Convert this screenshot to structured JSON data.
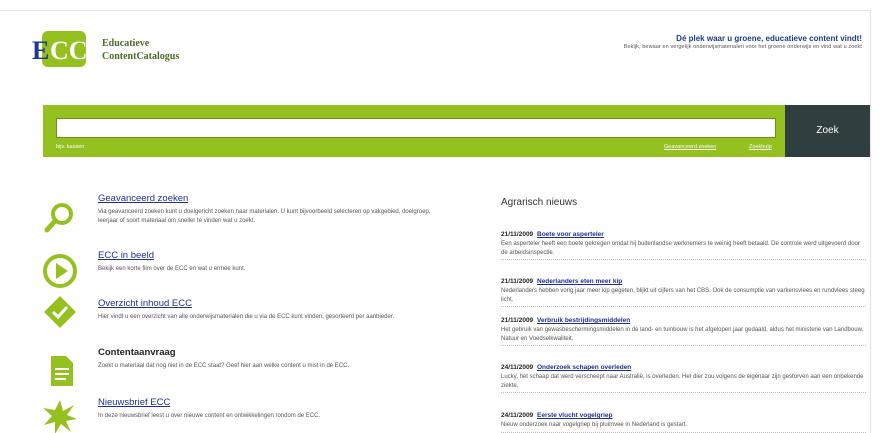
{
  "header": {
    "logo_line1": "Educatieve",
    "logo_line2": "ContentCatalogus",
    "tagline": "Dé plek waar u groene, educatieve content vindt!",
    "subtagline": "Bekijk, bewaar en vergelijk onderwijsmaterialen voor het groene onderwijs en vind wat u zoekt"
  },
  "search": {
    "value": "",
    "button_label": "Zoek",
    "hint": "bijv. kassen",
    "advanced_link": "Geavanceerd zoeken",
    "help_link": "Zoekhulp"
  },
  "features": [
    {
      "title": "Geavanceerd zoeken",
      "desc": "Via geavanceerd zoeken kunt u doelgericht zoeken naar materialen. U kunt bijvoorbeeld selecteren op vakgebied, doelgroep, leerjaar of soort materiaal om sneller te vinden wat u zoekt.",
      "icon": "magnifier-icon"
    },
    {
      "title": "ECC in beeld",
      "desc": "Bekijk een korte film over de ECC en wat u ermee kunt.",
      "icon": "play-icon"
    },
    {
      "title": "Overzicht inhoud ECC",
      "desc": "Hier vindt u een overzicht van alle onderwijsmaterialen die u via de ECC kunt vinden, gesorteerd per aanbieder.",
      "icon": "checklist-icon"
    },
    {
      "title": "Contentaanvraag",
      "desc": "Zoekt u materiaal dat nog niet in de ECC staat? Geef hier aan welke content u mist in de ECC.",
      "icon": "document-icon"
    },
    {
      "title": "Nieuwsbrief ECC",
      "desc": "In deze nieuwsbrief leest u over nieuwe content en ontwikkelingen rondom de ECC.",
      "icon": "starburst-icon"
    }
  ],
  "news": {
    "title": "Agrarisch nieuws",
    "items": [
      {
        "date": "21/11/2009",
        "headline": "Boete voor asperteler",
        "body": "Een asperteler heeft een boete gekregen omdat hij buitenlandse werknemers te weinig heeft betaald. De controle werd uitgevoerd door de arbeidsinspectie."
      },
      {
        "date": "21/11/2009",
        "headline": "Nederlanders eten meer kip",
        "body": "Nederlanders hebben vorig jaar meer kip gegeten, blijkt uit cijfers van het CBS. Ook de consumptie van varkensvlees en rundvlees steeg licht."
      },
      {
        "date": "21/11/2009",
        "headline": "Verbruik bestrijdingsmiddelen",
        "body": "Het gebruik van gewasbeschermingsmiddelen in de land- en tuinbouw is het afgelopen jaar gedaald, aldus het ministerie van Landbouw, Natuur en Voedselkwaliteit."
      },
      {
        "date": "24/11/2009",
        "headline": "Onderzoek schapen overleden",
        "body": "Lucky, het schaap dat werd verscheept naar Australië, is overleden. Het dier zou volgens de eigenaar zijn gestorven aan een onbekende ziekte."
      },
      {
        "date": "24/11/2009",
        "headline": "Eerste vlucht vogelgriep",
        "body": "Nieuw onderzoek naar vogelgriep bij pluimvee in Nederland is gestart."
      }
    ]
  },
  "colors": {
    "accent_green": "#94c11f",
    "dark_button": "#2f3e3e",
    "link_blue": "#1e2f8f"
  }
}
